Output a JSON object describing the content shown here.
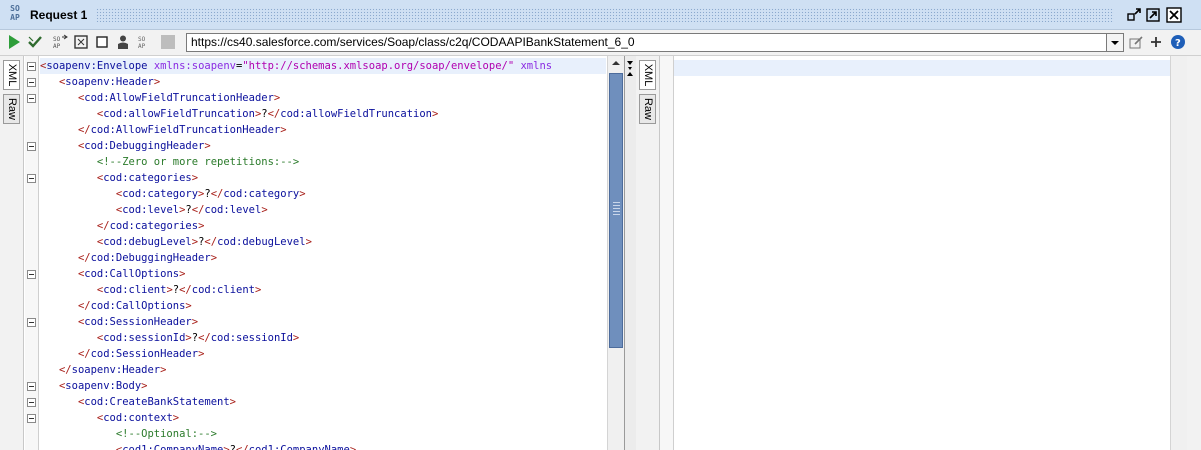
{
  "window": {
    "logo_text": "SO\nAP",
    "title": "Request 1"
  },
  "toolbar": {
    "url": "https://cs40.salesforce.com/services/Soap/class/c2q/CODAAPIBankStatement_6_0",
    "icons": [
      "run-icon",
      "validate-icon",
      "soap-ops-icon",
      "maximize-editor-icon",
      "stop-icon",
      "user-icon",
      "soap-settings-icon",
      "disabled-icon"
    ]
  },
  "left_tabs": {
    "xml": "XML",
    "raw": "Raw"
  },
  "right_tabs": {
    "xml": "XML",
    "raw": "Raw"
  },
  "editor_lines": [
    [
      {
        "k": "br",
        "t": "<"
      },
      {
        "k": "tag",
        "t": "soapenv:Envelope"
      },
      {
        "k": "text",
        "t": " "
      },
      {
        "k": "attr",
        "t": "xmlns:soapenv"
      },
      {
        "k": "eq",
        "t": "="
      },
      {
        "k": "val",
        "t": "\"http://schemas.xmlsoap.org/soap/envelope/\""
      },
      {
        "k": "text",
        "t": " "
      },
      {
        "k": "attr",
        "t": "xmlns"
      }
    ],
    [
      {
        "k": "text",
        "t": "   "
      },
      {
        "k": "br",
        "t": "<"
      },
      {
        "k": "tag",
        "t": "soapenv:Header"
      },
      {
        "k": "br",
        "t": ">"
      }
    ],
    [
      {
        "k": "text",
        "t": "      "
      },
      {
        "k": "br",
        "t": "<"
      },
      {
        "k": "tag",
        "t": "cod:AllowFieldTruncationHeader"
      },
      {
        "k": "br",
        "t": ">"
      }
    ],
    [
      {
        "k": "text",
        "t": "         "
      },
      {
        "k": "br",
        "t": "<"
      },
      {
        "k": "tag",
        "t": "cod:allowFieldTruncation"
      },
      {
        "k": "br",
        "t": ">"
      },
      {
        "k": "text",
        "t": "?"
      },
      {
        "k": "br",
        "t": "</"
      },
      {
        "k": "tag",
        "t": "cod:allowFieldTruncation"
      },
      {
        "k": "br",
        "t": ">"
      }
    ],
    [
      {
        "k": "text",
        "t": "      "
      },
      {
        "k": "br",
        "t": "</"
      },
      {
        "k": "tag",
        "t": "cod:AllowFieldTruncationHeader"
      },
      {
        "k": "br",
        "t": ">"
      }
    ],
    [
      {
        "k": "text",
        "t": "      "
      },
      {
        "k": "br",
        "t": "<"
      },
      {
        "k": "tag",
        "t": "cod:DebuggingHeader"
      },
      {
        "k": "br",
        "t": ">"
      }
    ],
    [
      {
        "k": "text",
        "t": "         "
      },
      {
        "k": "comment",
        "t": "<!--Zero or more repetitions:-->"
      }
    ],
    [
      {
        "k": "text",
        "t": "         "
      },
      {
        "k": "br",
        "t": "<"
      },
      {
        "k": "tag",
        "t": "cod:categories"
      },
      {
        "k": "br",
        "t": ">"
      }
    ],
    [
      {
        "k": "text",
        "t": "            "
      },
      {
        "k": "br",
        "t": "<"
      },
      {
        "k": "tag",
        "t": "cod:category"
      },
      {
        "k": "br",
        "t": ">"
      },
      {
        "k": "text",
        "t": "?"
      },
      {
        "k": "br",
        "t": "</"
      },
      {
        "k": "tag",
        "t": "cod:category"
      },
      {
        "k": "br",
        "t": ">"
      }
    ],
    [
      {
        "k": "text",
        "t": "            "
      },
      {
        "k": "br",
        "t": "<"
      },
      {
        "k": "tag",
        "t": "cod:level"
      },
      {
        "k": "br",
        "t": ">"
      },
      {
        "k": "text",
        "t": "?"
      },
      {
        "k": "br",
        "t": "</"
      },
      {
        "k": "tag",
        "t": "cod:level"
      },
      {
        "k": "br",
        "t": ">"
      }
    ],
    [
      {
        "k": "text",
        "t": "         "
      },
      {
        "k": "br",
        "t": "</"
      },
      {
        "k": "tag",
        "t": "cod:categories"
      },
      {
        "k": "br",
        "t": ">"
      }
    ],
    [
      {
        "k": "text",
        "t": "         "
      },
      {
        "k": "br",
        "t": "<"
      },
      {
        "k": "tag",
        "t": "cod:debugLevel"
      },
      {
        "k": "br",
        "t": ">"
      },
      {
        "k": "text",
        "t": "?"
      },
      {
        "k": "br",
        "t": "</"
      },
      {
        "k": "tag",
        "t": "cod:debugLevel"
      },
      {
        "k": "br",
        "t": ">"
      }
    ],
    [
      {
        "k": "text",
        "t": "      "
      },
      {
        "k": "br",
        "t": "</"
      },
      {
        "k": "tag",
        "t": "cod:DebuggingHeader"
      },
      {
        "k": "br",
        "t": ">"
      }
    ],
    [
      {
        "k": "text",
        "t": "      "
      },
      {
        "k": "br",
        "t": "<"
      },
      {
        "k": "tag",
        "t": "cod:CallOptions"
      },
      {
        "k": "br",
        "t": ">"
      }
    ],
    [
      {
        "k": "text",
        "t": "         "
      },
      {
        "k": "br",
        "t": "<"
      },
      {
        "k": "tag",
        "t": "cod:client"
      },
      {
        "k": "br",
        "t": ">"
      },
      {
        "k": "text",
        "t": "?"
      },
      {
        "k": "br",
        "t": "</"
      },
      {
        "k": "tag",
        "t": "cod:client"
      },
      {
        "k": "br",
        "t": ">"
      }
    ],
    [
      {
        "k": "text",
        "t": "      "
      },
      {
        "k": "br",
        "t": "</"
      },
      {
        "k": "tag",
        "t": "cod:CallOptions"
      },
      {
        "k": "br",
        "t": ">"
      }
    ],
    [
      {
        "k": "text",
        "t": "      "
      },
      {
        "k": "br",
        "t": "<"
      },
      {
        "k": "tag",
        "t": "cod:SessionHeader"
      },
      {
        "k": "br",
        "t": ">"
      }
    ],
    [
      {
        "k": "text",
        "t": "         "
      },
      {
        "k": "br",
        "t": "<"
      },
      {
        "k": "tag",
        "t": "cod:sessionId"
      },
      {
        "k": "br",
        "t": ">"
      },
      {
        "k": "text",
        "t": "?"
      },
      {
        "k": "br",
        "t": "</"
      },
      {
        "k": "tag",
        "t": "cod:sessionId"
      },
      {
        "k": "br",
        "t": ">"
      }
    ],
    [
      {
        "k": "text",
        "t": "      "
      },
      {
        "k": "br",
        "t": "</"
      },
      {
        "k": "tag",
        "t": "cod:SessionHeader"
      },
      {
        "k": "br",
        "t": ">"
      }
    ],
    [
      {
        "k": "text",
        "t": "   "
      },
      {
        "k": "br",
        "t": "</"
      },
      {
        "k": "tag",
        "t": "soapenv:Header"
      },
      {
        "k": "br",
        "t": ">"
      }
    ],
    [
      {
        "k": "text",
        "t": "   "
      },
      {
        "k": "br",
        "t": "<"
      },
      {
        "k": "tag",
        "t": "soapenv:Body"
      },
      {
        "k": "br",
        "t": ">"
      }
    ],
    [
      {
        "k": "text",
        "t": "      "
      },
      {
        "k": "br",
        "t": "<"
      },
      {
        "k": "tag",
        "t": "cod:CreateBankStatement"
      },
      {
        "k": "br",
        "t": ">"
      }
    ],
    [
      {
        "k": "text",
        "t": "         "
      },
      {
        "k": "br",
        "t": "<"
      },
      {
        "k": "tag",
        "t": "cod:context"
      },
      {
        "k": "br",
        "t": ">"
      }
    ],
    [
      {
        "k": "text",
        "t": "            "
      },
      {
        "k": "comment",
        "t": "<!--Optional:-->"
      }
    ],
    [
      {
        "k": "text",
        "t": "            "
      },
      {
        "k": "br",
        "t": "<"
      },
      {
        "k": "tag",
        "t": "cod1:CompanyName"
      },
      {
        "k": "br",
        "t": ">"
      },
      {
        "k": "text",
        "t": "?"
      },
      {
        "k": "br",
        "t": "</"
      },
      {
        "k": "tag",
        "t": "cod1:CompanyName"
      },
      {
        "k": "br",
        "t": ">"
      }
    ]
  ],
  "fold_lines": [
    0,
    1,
    2,
    5,
    7,
    13,
    16,
    20,
    21,
    22
  ]
}
